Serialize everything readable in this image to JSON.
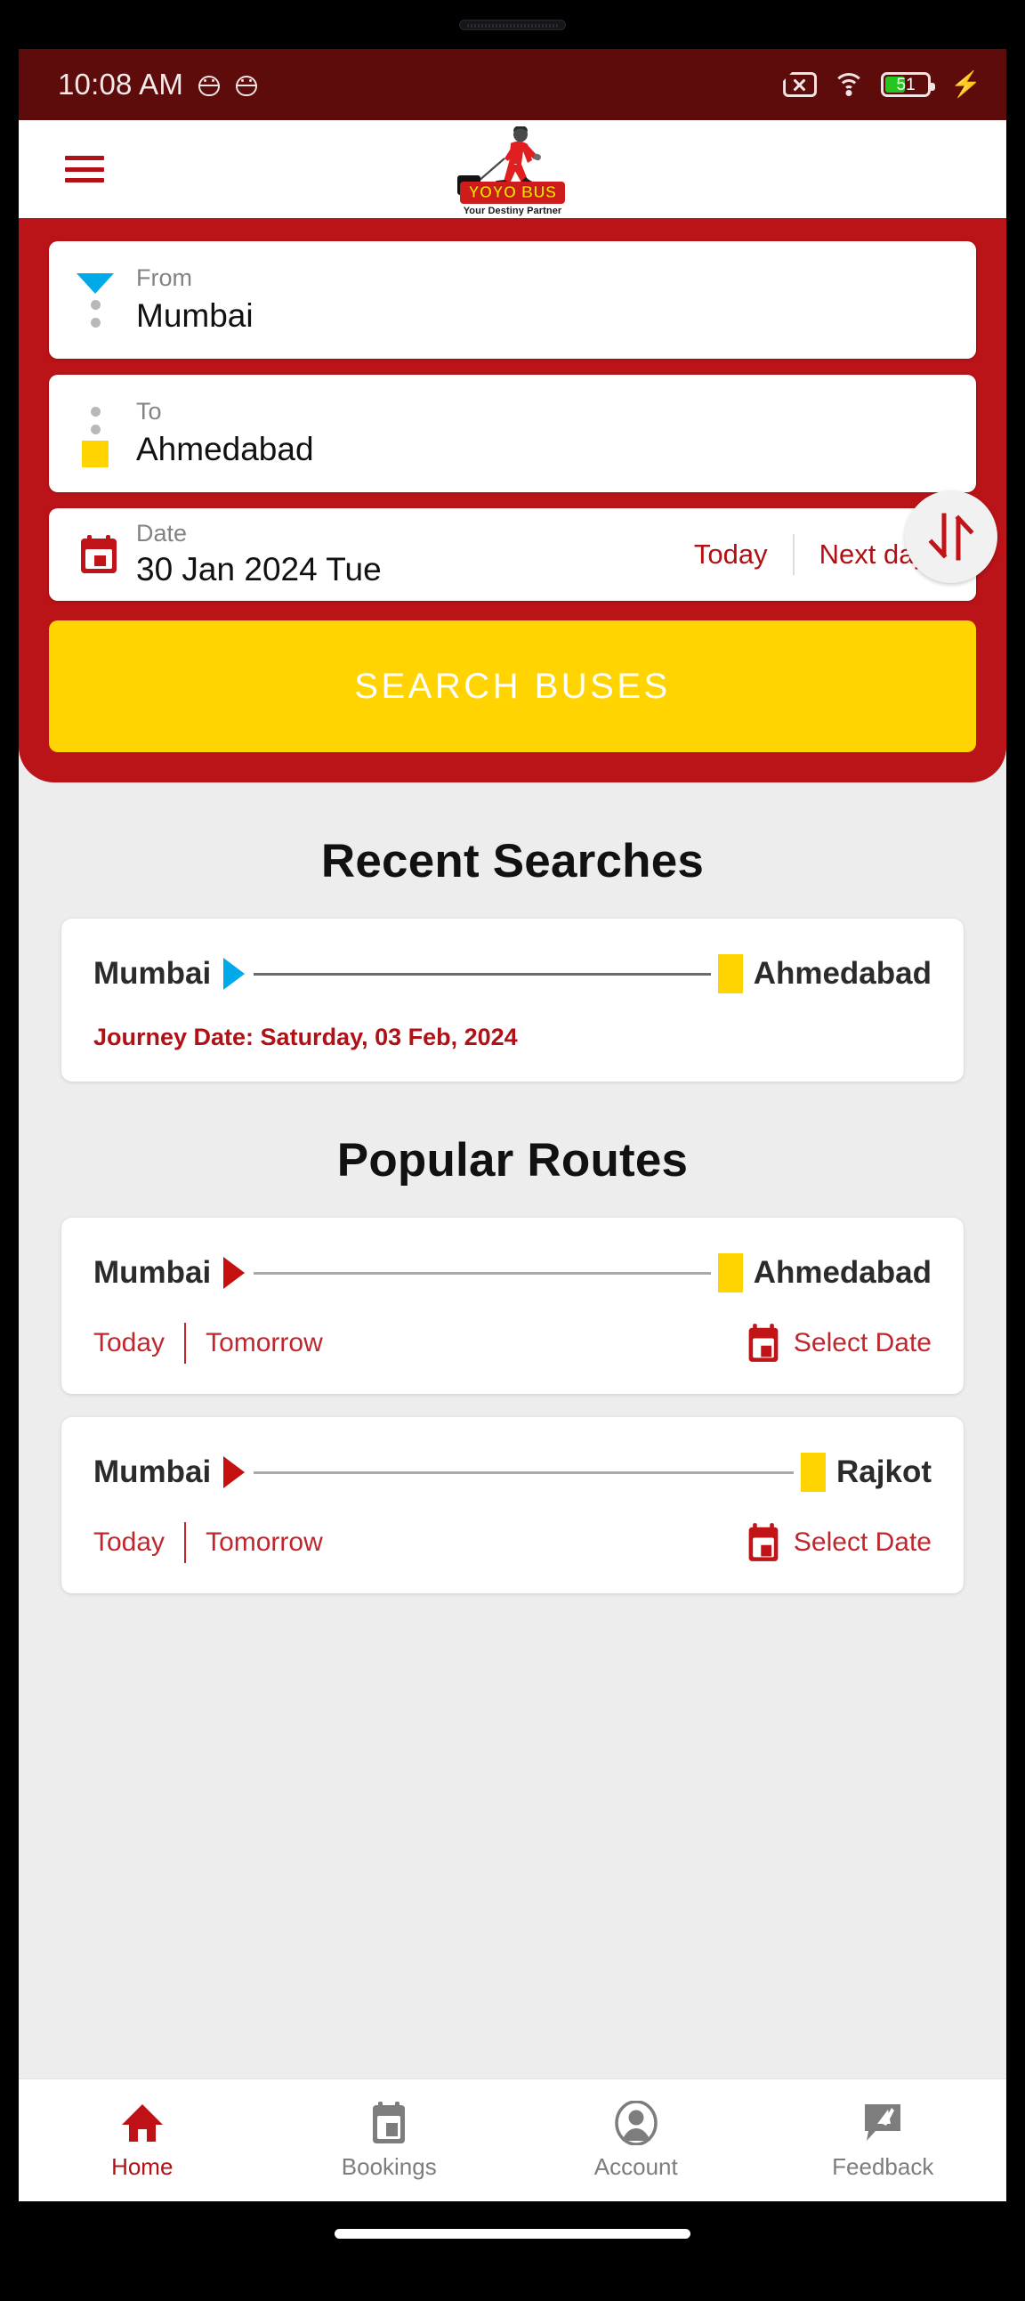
{
  "status_bar": {
    "time": "10:08 AM",
    "battery_level": "51",
    "battery_percent": 51,
    "icons": [
      "android-notification-icon",
      "android-notification-icon",
      "no-sim-icon",
      "wifi-icon",
      "battery-icon",
      "charging-bolt-icon"
    ]
  },
  "app_bar": {
    "menu_icon": "hamburger-menu-icon",
    "logo_name": "YOYO BUS",
    "logo_tagline": "Your Destiny Partner"
  },
  "search_panel": {
    "from": {
      "label": "From",
      "value": "Mumbai",
      "marker": "blue-triangle-marker"
    },
    "to": {
      "label": "To",
      "value": "Ahmedabad",
      "marker": "yellow-square-marker"
    },
    "swap_icon": "swap-vertical-icon",
    "date": {
      "label": "Date",
      "value": "30 Jan 2024 Tue",
      "icon": "calendar-icon",
      "today_label": "Today",
      "next_day_label": "Next day"
    },
    "search_button_label": "SEARCH BUSES"
  },
  "recent_searches": {
    "title": "Recent Searches",
    "items": [
      {
        "origin": "Mumbai",
        "destination": "Ahmedabad",
        "journey_date": "Journey Date: Saturday, 03 Feb, 2024"
      }
    ]
  },
  "popular_routes": {
    "title": "Popular Routes",
    "items": [
      {
        "origin": "Mumbai",
        "destination": "Ahmedabad",
        "today_label": "Today",
        "tomorrow_label": "Tomorrow",
        "select_date_label": "Select Date"
      },
      {
        "origin": "Mumbai",
        "destination": "Rajkot",
        "today_label": "Today",
        "tomorrow_label": "Tomorrow",
        "select_date_label": "Select Date"
      }
    ]
  },
  "bottom_nav": {
    "items": [
      {
        "label": "Home",
        "icon": "home-icon",
        "active": true
      },
      {
        "label": "Bookings",
        "icon": "bookings-icon",
        "active": false
      },
      {
        "label": "Account",
        "icon": "account-icon",
        "active": false
      },
      {
        "label": "Feedback",
        "icon": "feedback-icon",
        "active": false
      }
    ]
  },
  "colors": {
    "brand_red": "#ba1318",
    "dark_red": "#5e0b0b",
    "accent_yellow": "#ffd400",
    "link_red": "#b01116",
    "marker_blue": "#00a9e8"
  }
}
